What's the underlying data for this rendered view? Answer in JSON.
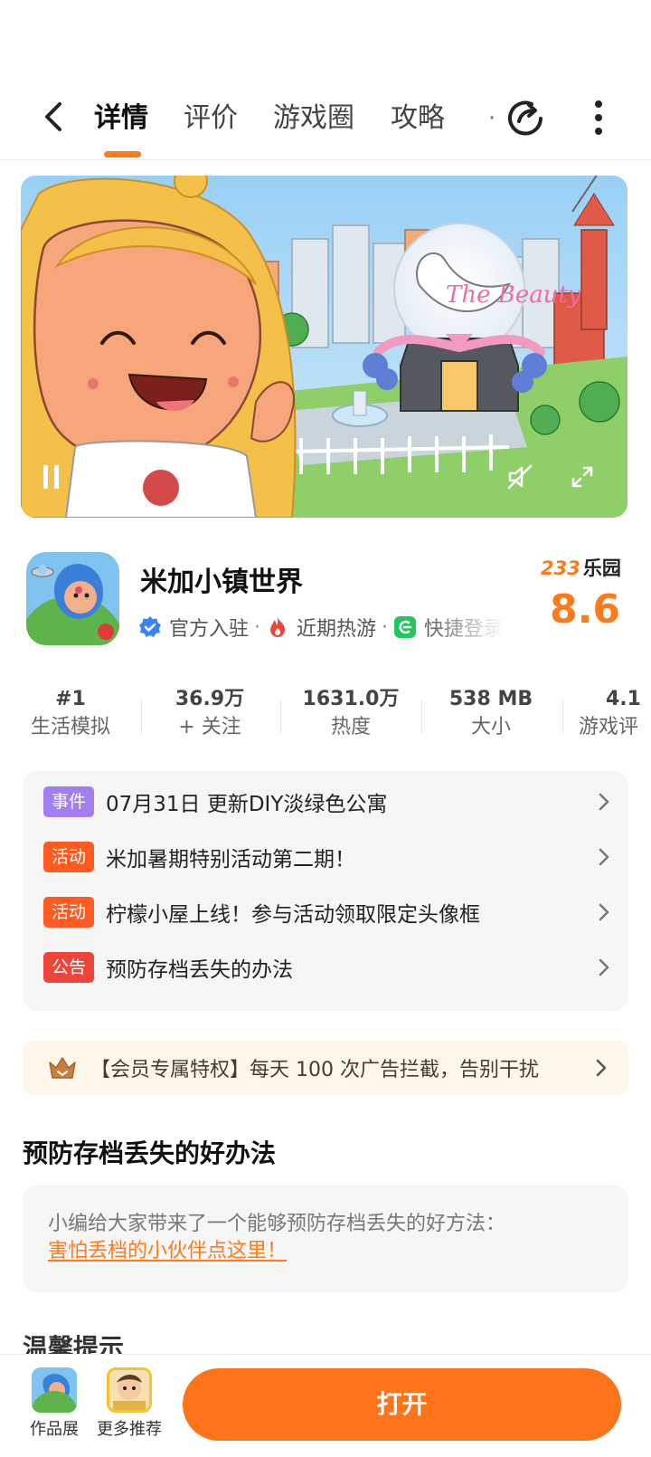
{
  "nav": {
    "tabs": [
      {
        "label": "详情",
        "active": true
      },
      {
        "label": "评价",
        "active": false
      },
      {
        "label": "游戏圈",
        "active": false
      },
      {
        "label": "攻略",
        "active": false
      }
    ],
    "overflow_indicator": "·",
    "accent_color": "#ff7a1a"
  },
  "banner": {
    "title_sign": "The Beauty",
    "video_state": "paused"
  },
  "app": {
    "name": "米加小镇世界",
    "tags": [
      {
        "icon": "verified-icon",
        "label": "官方入驻"
      },
      {
        "icon": "fire-icon",
        "label": "近期热游"
      },
      {
        "icon": "shortcut-icon",
        "label": "快捷登录"
      }
    ],
    "tag_separator": "·",
    "brand_233": "233",
    "brand_suffix": "乐园",
    "score": "8.6"
  },
  "stats": [
    {
      "value": "#1",
      "label": "生活模拟"
    },
    {
      "value": "36.9万",
      "label": "+ 关注"
    },
    {
      "value": "1631.0万",
      "label": "热度"
    },
    {
      "value": "538 MB",
      "label": "大小"
    },
    {
      "value": "4.1",
      "label": "游戏评"
    }
  ],
  "news": [
    {
      "badge": "事件",
      "badge_color": "#a27ef0",
      "text": "07月31日  更新DIY淡绿色公寓"
    },
    {
      "badge": "活动",
      "badge_color": "#ff5a1f",
      "text": "米加暑期特别活动第二期！"
    },
    {
      "badge": "活动",
      "badge_color": "#ff5a1f",
      "text": "柠檬小屋上线！参与活动领取限定头像框"
    },
    {
      "badge": "公告",
      "badge_color": "#f0433a",
      "text": "预防存档丢失的办法"
    }
  ],
  "vip": {
    "text": "【会员专属特权】每天 100 次广告拦截，告别干扰"
  },
  "tips_section": {
    "title": "预防存档丢失的好办法",
    "line1": "小编给大家带来了一个能够预防存档丢失的好方法：",
    "link": "害怕丢档的小伙伴点这里！"
  },
  "next_section": {
    "title": "温馨提示"
  },
  "bottom_bar": {
    "gallery_label": "作品展",
    "more_label": "更多推荐",
    "open_label": "打开",
    "open_color": "#ff7418"
  }
}
